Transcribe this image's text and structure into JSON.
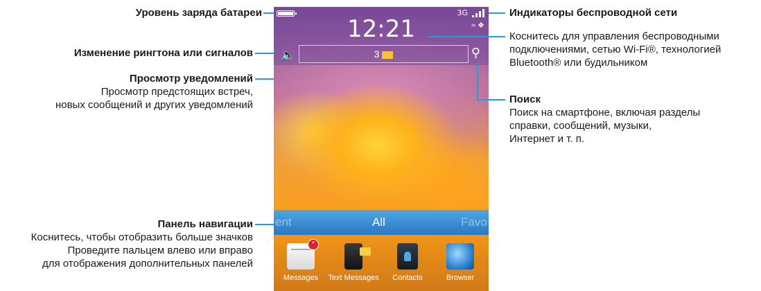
{
  "callouts": {
    "battery": {
      "title": "Уровень заряда батареи"
    },
    "ringtone": {
      "title": "Изменение рингтона или сигналов"
    },
    "notifications": {
      "title": "Просмотр уведомлений",
      "line1": "Просмотр предстоящих встреч,",
      "line2": "новых сообщений и других уведомлений"
    },
    "navigation": {
      "title": "Панель навигации",
      "line1": "Коснитесь, чтобы отобразить больше значков",
      "line2": "Проведите пальцем влево или вправо",
      "line3": "для отображения дополнительных панелей"
    },
    "wireless_indicators": {
      "title": "Индикаторы беспроводной сети"
    },
    "wireless_manage": {
      "line1": "Коснитесь для управления беспроводными",
      "line2": "подключениями, сетью Wi-Fi®, технологией",
      "line3": "Bluetooth® или будильником"
    },
    "search": {
      "title": "Поиск",
      "line1": "Поиск на смартфоне, включая разделы",
      "line2": "справки, сообщений, музыки,",
      "line3": "Интернет и т. п."
    }
  },
  "phone": {
    "clock": "12:21",
    "network_label": "3G",
    "notification_count": "3",
    "nav": {
      "left": "ent",
      "center": "All",
      "right": "Favo"
    },
    "apps": [
      {
        "label": "Messages",
        "icon": "messages-icon",
        "badge": "*"
      },
      {
        "label": "Text Messages",
        "icon": "text-messages-icon"
      },
      {
        "label": "Contacts",
        "icon": "contacts-icon"
      },
      {
        "label": "Browser",
        "icon": "browser-icon"
      }
    ]
  },
  "colors": {
    "leader": "#1f9fd8",
    "nav_bar": "#3a8fd6",
    "text": "#1a1a1a"
  }
}
